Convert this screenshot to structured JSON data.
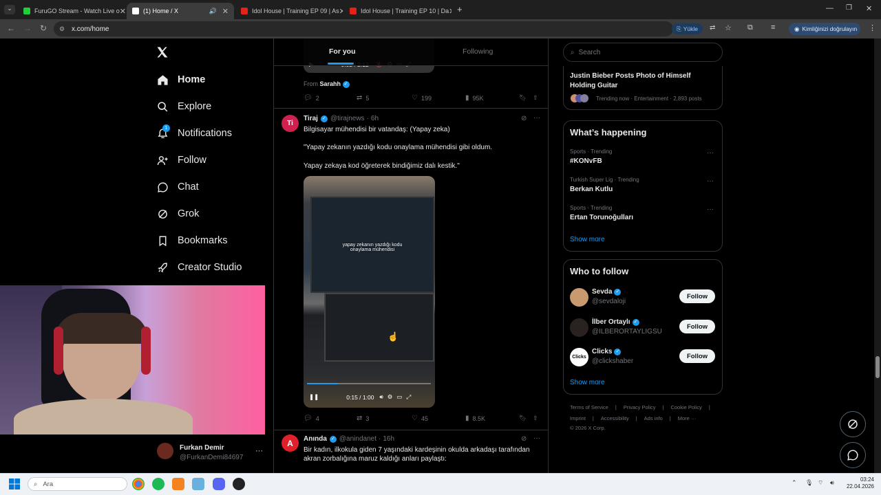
{
  "browser": {
    "tabs": [
      {
        "title": "FuruGO Stream - Watch Live o",
        "color": "#1fcf3a"
      },
      {
        "title": "(1) Home / X",
        "color": "#ffffff"
      },
      {
        "title": "Idol House | Training EP 09 | As",
        "color": "#e62117"
      },
      {
        "title": "Idol House | Training EP 10 | Da",
        "color": "#e62117"
      }
    ],
    "url": "x.com/home",
    "yukle_label": "Yükle",
    "verify_label": "Kimliğinizi doğrulayın"
  },
  "nav": {
    "items": [
      {
        "label": "Home",
        "icon": "home-icon"
      },
      {
        "label": "Explore",
        "icon": "search-icon"
      },
      {
        "label": "Notifications",
        "icon": "bell-icon",
        "badge": "1"
      },
      {
        "label": "Follow",
        "icon": "follow-icon"
      },
      {
        "label": "Chat",
        "icon": "chat-icon"
      },
      {
        "label": "Grok",
        "icon": "grok-icon"
      },
      {
        "label": "Bookmarks",
        "icon": "bookmark-icon"
      },
      {
        "label": "Creator Studio",
        "icon": "rocket-icon"
      }
    ],
    "account": {
      "name": "Furkan Demir",
      "handle": "@FurkanDemi84697"
    }
  },
  "feed": {
    "tabs": [
      "For you",
      "Following"
    ],
    "post1": {
      "video_time": "0:02 / 2:12",
      "from_label": "From",
      "from_name": "Sarahh",
      "replies": "2",
      "reposts": "5",
      "likes": "199",
      "views": "95K"
    },
    "post2": {
      "name": "Tiraj",
      "handle": "@tirajnews",
      "time": "6h",
      "avatar_letter": "Ti",
      "line1": "Bilgisayar mühendisi bir vatandaş: (Yapay zeka)",
      "line2": "\"Yapay zekanın yazdığı kodu onaylama mühendisi gibi oldum.",
      "line3": "Yapay zekaya kod öğreterek bindiğimiz dalı kestik.\"",
      "caption1": "yapay zekanın yazdığı kodu",
      "caption2": "onaylama mühendisi",
      "video_time": "0:15 / 1:00",
      "replies": "4",
      "reposts": "3",
      "likes": "45",
      "views": "8.5K"
    },
    "post3": {
      "name": "Anında",
      "handle": "@anindanet",
      "time": "16h",
      "avatar_letter": "A",
      "line1": "Bir kadın, ilkokula giden 7 yaşındaki kardeşinin okulda arkadaşı tarafından",
      "line2": "akran zorbalığına maruz kaldığı anları paylaştı:"
    }
  },
  "right": {
    "search_placeholder": "Search",
    "top_trend": {
      "title1": "Justin Bieber Posts Photo of Himself",
      "title2": "Holding Guitar",
      "meta": "Trending now · Entertainment · 2,893 posts"
    },
    "happening": {
      "heading": "What’s happening",
      "trends": [
        {
          "meta": "Sports · Trending",
          "name": "#KONvFB"
        },
        {
          "meta": "Turkish Super Lig · Trending",
          "name": "Berkan Kutlu"
        },
        {
          "meta": "Sports · Trending",
          "name": "Ertan Torunoğulları"
        }
      ],
      "show_more": "Show more"
    },
    "who_to_follow": {
      "heading": "Who to follow",
      "users": [
        {
          "name": "Sevda",
          "handle": "@sevdaloji",
          "button": "Follow"
        },
        {
          "name": "İlber Ortaylı",
          "handle": "@ILBERORTAYLIGSU",
          "button": "Follow"
        },
        {
          "name": "Clicks",
          "handle": "@clickshaber",
          "button": "Follow"
        }
      ],
      "show_more": "Show more"
    },
    "footer": {
      "row1": [
        "Terms of Service",
        "Privacy Policy",
        "Cookie Policy"
      ],
      "row2": [
        "Imprint",
        "Accessibility",
        "Ads info",
        "More ···"
      ],
      "copyright": "© 2026 X Corp."
    }
  },
  "taskbar": {
    "search_placeholder": "Ara",
    "time": "03:24",
    "date": "22.04.2026"
  }
}
